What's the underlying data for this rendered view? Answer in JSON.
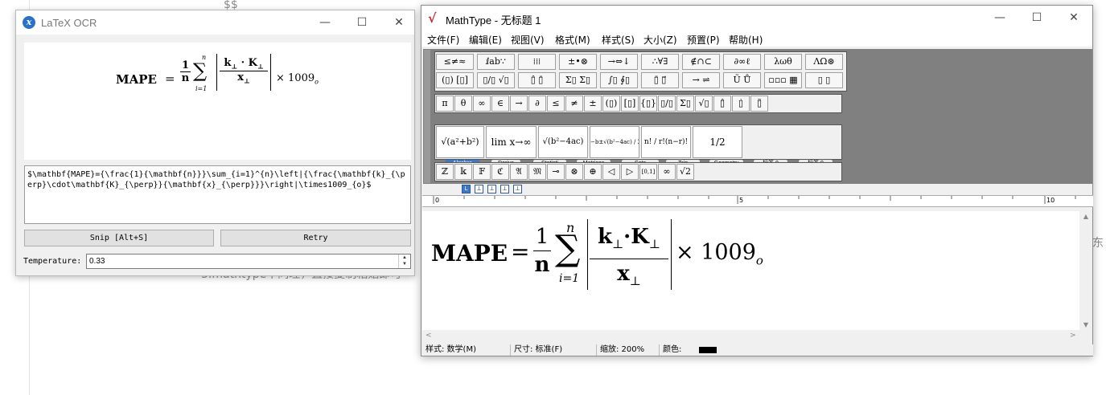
{
  "background": {
    "dollar": "$$",
    "partial_line": "3.mathtype中同理，直接复制粘贴即可",
    "side_char": "东"
  },
  "ocr_window": {
    "title": "LaTeX OCR",
    "minimize": "—",
    "maximize": "☐",
    "close": "✕",
    "latex_text": "$\\mathbf{MAPE}={\\frac{1}{\\mathbf{n}}}\\sum_{i=1}^{n}\\left|{\\frac{\\mathbf{k}_{\\perp}\\cdot\\mathbf{K}_{\\perp}}{\\mathbf{x}_{\\perp}}}\\right|\\times1009_{o}$",
    "snip_label": "Snip [Alt+S]",
    "retry_label": "Retry",
    "temperature_label": "Temperature:",
    "temperature_value": "0.33"
  },
  "formula": {
    "lhs": "MAPE",
    "eq": "=",
    "frac1_num": "1",
    "frac1_den": "n",
    "sum": "∑",
    "sum_upper": "n",
    "sum_lower": "i=1",
    "num_k": "k",
    "perp": "⊥",
    "cdot": "·",
    "num_K": "K",
    "den_x": "x",
    "times_tail": "× 1009",
    "sub_o": "o"
  },
  "mathtype": {
    "title": "MathType - 无标题 1",
    "minimize": "—",
    "maximize": "☐",
    "close": "✕",
    "menus": [
      "文件(F)",
      "编辑(E)",
      "视图(V)",
      "格式(M)",
      "样式(S)",
      "大小(Z)",
      "预置(P)",
      "帮助(H)"
    ],
    "palette_row1": [
      "≤≠≈",
      "ⅈab∵",
      "⁞⁞⁞",
      "±•⊗",
      "→⇔↓",
      "∴∀∃",
      "∉∩⊂",
      "∂∞ℓ",
      "λωθ",
      "ΛΩ⊛"
    ],
    "palette_row2": [
      "(▯) [▯]",
      "▯/▯ √▯",
      "▯̂ ▯̄",
      "Σ▯ Σ▯",
      "∫▯ ∮▯",
      "▯̄ ▯⃗",
      "→ ⇌",
      "Ũ Ů",
      "▫▫▫ ▦",
      "▯ ▯"
    ],
    "symbol_row": [
      "π",
      "θ",
      "∞",
      "∈",
      "→",
      "∂",
      "≤",
      "≠",
      "±",
      "(▯)",
      "[▯]",
      "{▯}",
      "▯/▯",
      "Σ▯",
      "√▯",
      "▯̂",
      "▯̇",
      "▯̃"
    ],
    "tabs": [
      "Algebra",
      "Derivs",
      "Statisti",
      "Matrices",
      "Sets",
      "Trig",
      "Geometry",
      "标签 8",
      "标签 9"
    ],
    "templates": [
      "√(a²+b²)",
      "lim x→∞",
      "√(b²−4ac)",
      "−b±√(b²−4ac) / 2a",
      "n! / r!(n−r)!",
      "1/2"
    ],
    "bottom_row": [
      "ℤ",
      "𝕜",
      "𝔽",
      "ℭ",
      "𝔄",
      "𝔐",
      "⊸",
      "⊗",
      "⊕",
      "◁",
      "▷",
      "[0,1]",
      "∞",
      "√2"
    ],
    "ruler_marks": [
      "0",
      "5",
      "10"
    ],
    "status": {
      "style": "样式: 数学(M)",
      "size": "尺寸: 标准(F)",
      "zoom": "缩放: 200%",
      "color_label": "颜色:"
    }
  }
}
